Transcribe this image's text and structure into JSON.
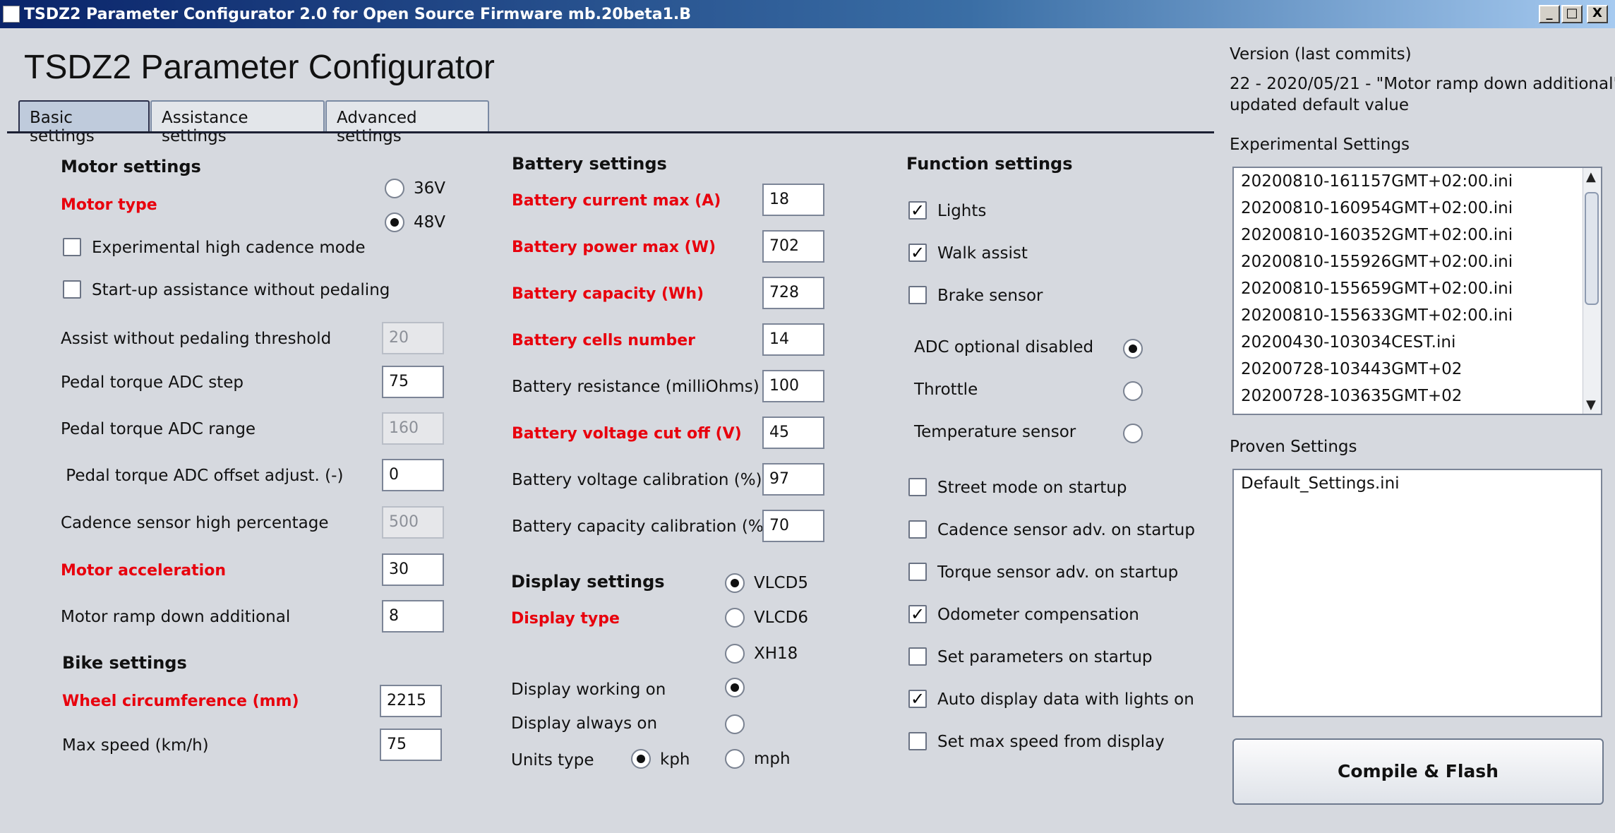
{
  "window": {
    "title": "TSDZ2 Parameter Configurator 2.0 for Open Source Firmware mb.20beta1.B",
    "minimize": "_",
    "maximize": "□",
    "close": "X"
  },
  "app_title": "TSDZ2 Parameter Configurator",
  "tabs": [
    "Basic settings",
    "Assistance settings",
    "Advanced settings"
  ],
  "motor": {
    "section": "Motor settings",
    "motor_type_label": "Motor type",
    "options": [
      "36V",
      "48V"
    ],
    "selected": "48V",
    "checkbox_high_cadence": "Experimental high cadence mode",
    "checkbox_startup_assist": "Start-up assistance without pedaling",
    "fields": [
      {
        "label": "Assist without pedaling threshold",
        "value": "20",
        "disabled": true,
        "red": false
      },
      {
        "label": "Pedal torque ADC step",
        "value": "75",
        "disabled": false,
        "red": false
      },
      {
        "label": "Pedal torque ADC range",
        "value": "160",
        "disabled": true,
        "red": false
      },
      {
        "label": " Pedal torque ADC offset adjust. (-)",
        "value": "0",
        "disabled": false,
        "red": false
      },
      {
        "label": "Cadence sensor high percentage",
        "value": "500",
        "disabled": true,
        "red": false
      },
      {
        "label": "Motor acceleration",
        "value": "30",
        "disabled": false,
        "red": true
      },
      {
        "label": "Motor ramp down additional",
        "value": "8",
        "disabled": false,
        "red": false
      }
    ]
  },
  "bike": {
    "section": "Bike settings",
    "fields": [
      {
        "label": "Wheel circumference (mm)",
        "value": "2215",
        "red": true
      },
      {
        "label": "Max speed (km/h)",
        "value": "75",
        "red": false
      }
    ]
  },
  "battery": {
    "section": "Battery settings",
    "fields": [
      {
        "label": "Battery current max (A)",
        "value": "18",
        "red": true
      },
      {
        "label": "Battery power max (W)",
        "value": "702",
        "red": true
      },
      {
        "label": "Battery capacity (Wh)",
        "value": "728",
        "red": true
      },
      {
        "label": "Battery cells number",
        "value": "14",
        "red": true
      },
      {
        "label": "Battery resistance (milliOhms)",
        "value": "100",
        "red": false
      },
      {
        "label": "Battery voltage cut off (V)",
        "value": "45",
        "red": true
      },
      {
        "label": "Battery voltage calibration (%)",
        "value": "97",
        "red": false
      },
      {
        "label": "Battery capacity calibration (%)",
        "value": "70",
        "red": false
      }
    ]
  },
  "display": {
    "section": "Display settings",
    "type_label": "Display type",
    "types": [
      "VLCD5",
      "VLCD6",
      "XH18"
    ],
    "selected_type": "VLCD5",
    "working_on": "Display working on",
    "always_on": "Display always on",
    "units_label": "Units type",
    "units": [
      "kph",
      "mph"
    ],
    "selected_unit": "kph"
  },
  "functions": {
    "section": "Function settings",
    "top_checks": [
      {
        "label": "Lights",
        "checked": true
      },
      {
        "label": "Walk assist",
        "checked": true
      },
      {
        "label": "Brake sensor",
        "checked": false
      }
    ],
    "adc_options": [
      "ADC optional disabled",
      "Throttle",
      "Temperature sensor"
    ],
    "adc_selected": "ADC optional disabled",
    "bottom_checks": [
      {
        "label": "Street mode on startup",
        "checked": false
      },
      {
        "label": "Cadence sensor adv. on startup",
        "checked": false
      },
      {
        "label": "Torque sensor adv. on startup",
        "checked": false
      },
      {
        "label": "Odometer compensation",
        "checked": true
      },
      {
        "label": "Set parameters on startup",
        "checked": false
      },
      {
        "label": "Auto display data with lights on",
        "checked": true
      },
      {
        "label": "Set max speed from display",
        "checked": false
      }
    ],
    "check_mark": "✓"
  },
  "sidebar": {
    "version_label": "Version (last commits)",
    "version_line1": "22 - 2020/05/21 - \"Motor ramp down additional\"",
    "version_line2": "updated default value",
    "experimental_label": "Experimental Settings",
    "experimental_items": [
      "20200810-161157GMT+02:00.ini",
      "20200810-160954GMT+02:00.ini",
      "20200810-160352GMT+02:00.ini",
      "20200810-155926GMT+02:00.ini",
      "20200810-155659GMT+02:00.ini",
      "20200810-155633GMT+02:00.ini",
      "20200430-103034CEST.ini",
      "20200728-103443GMT+02",
      "20200728-103635GMT+02"
    ],
    "scroll_up": "▲",
    "scroll_down": "▼",
    "proven_label": "Proven Settings",
    "proven_items": [
      "Default_Settings.ini"
    ],
    "compile_button": "Compile & Flash"
  }
}
